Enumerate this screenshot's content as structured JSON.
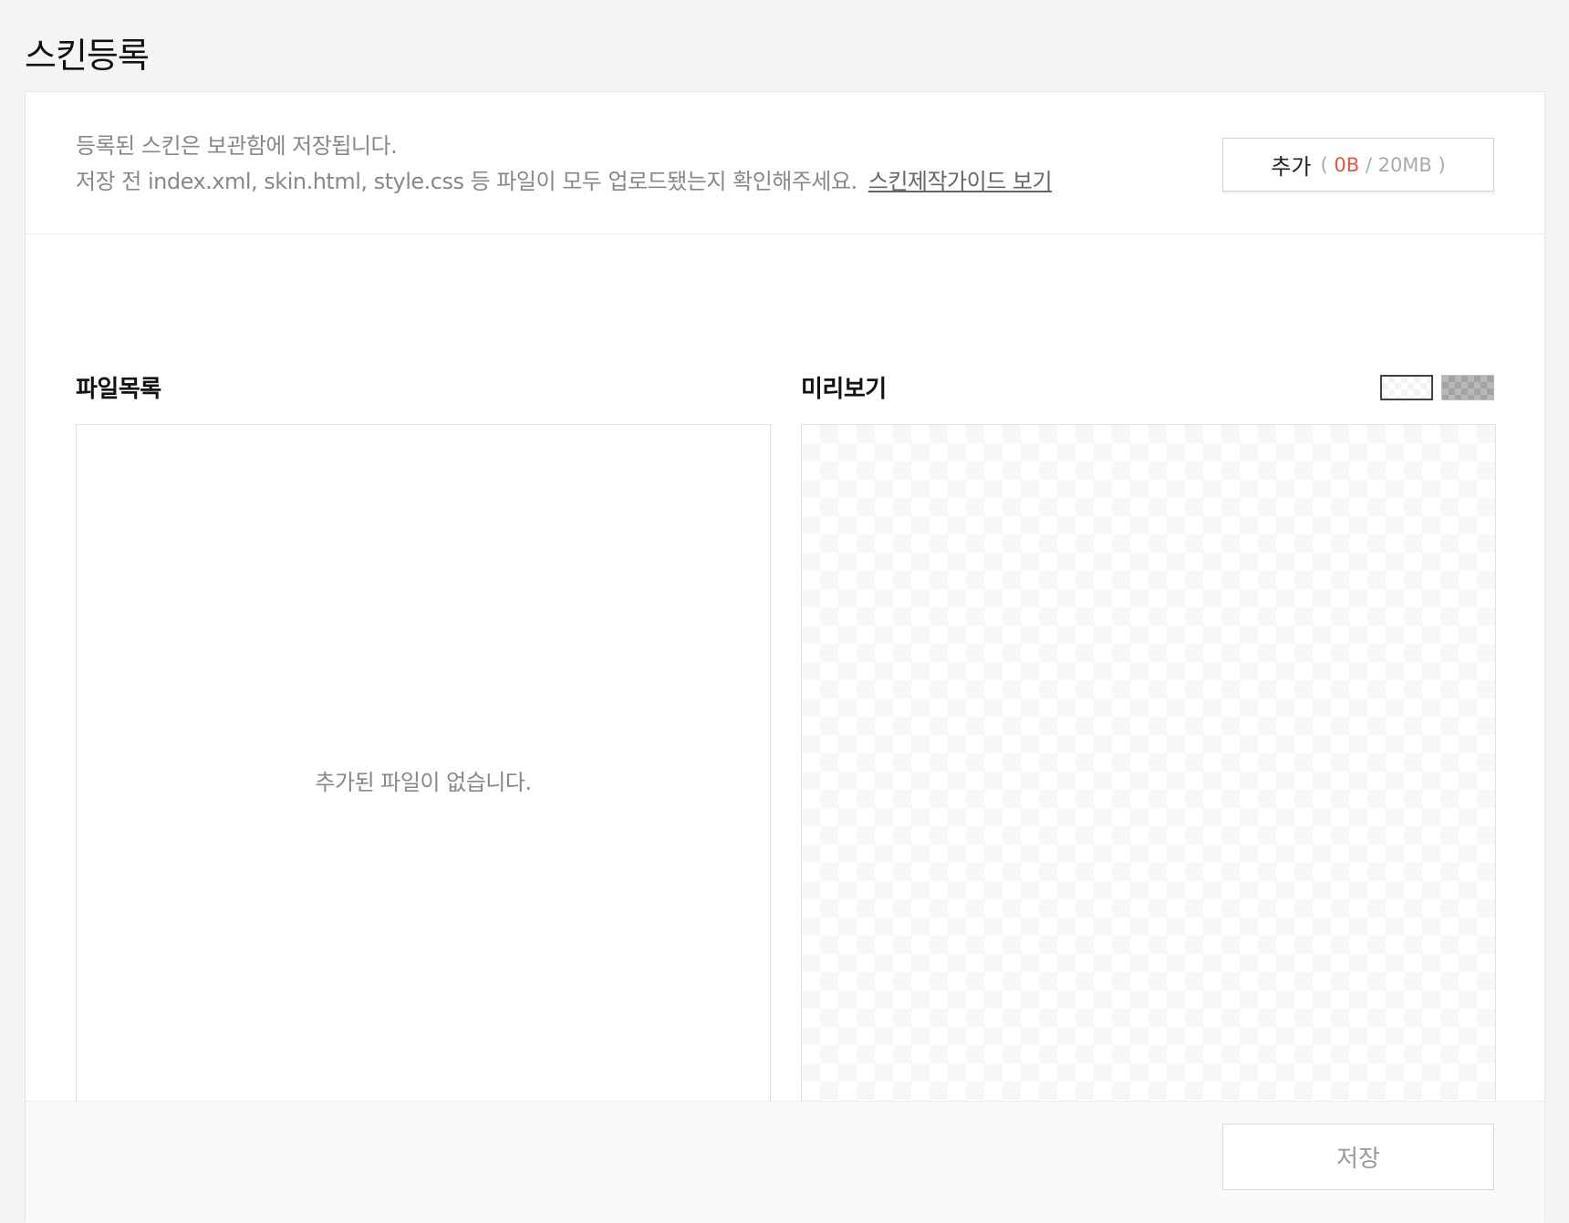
{
  "page": {
    "title": "스킨등록"
  },
  "info": {
    "line1": "등록된 스킨은 보관함에 저장됩니다.",
    "line2": "저장 전 index.xml, skin.html, style.css 등 파일이 모두 업로드됐는지 확인해주세요.",
    "guide_link": "스킨제작가이드 보기"
  },
  "add_button": {
    "label": "추가",
    "open_paren": "(",
    "used": "0B",
    "separator": "/",
    "limit": "20MB",
    "close_paren": ")"
  },
  "file_list": {
    "heading": "파일목록",
    "empty_message": "추가된 파일이 없습니다."
  },
  "preview": {
    "heading": "미리보기",
    "bg_options": [
      {
        "name": "light-checker",
        "selected": true
      },
      {
        "name": "dark-checker",
        "selected": false
      }
    ]
  },
  "footer": {
    "save_label": "저장"
  },
  "colors": {
    "accent_used": "#e0573f",
    "page_bg": "#f3f4f6"
  }
}
